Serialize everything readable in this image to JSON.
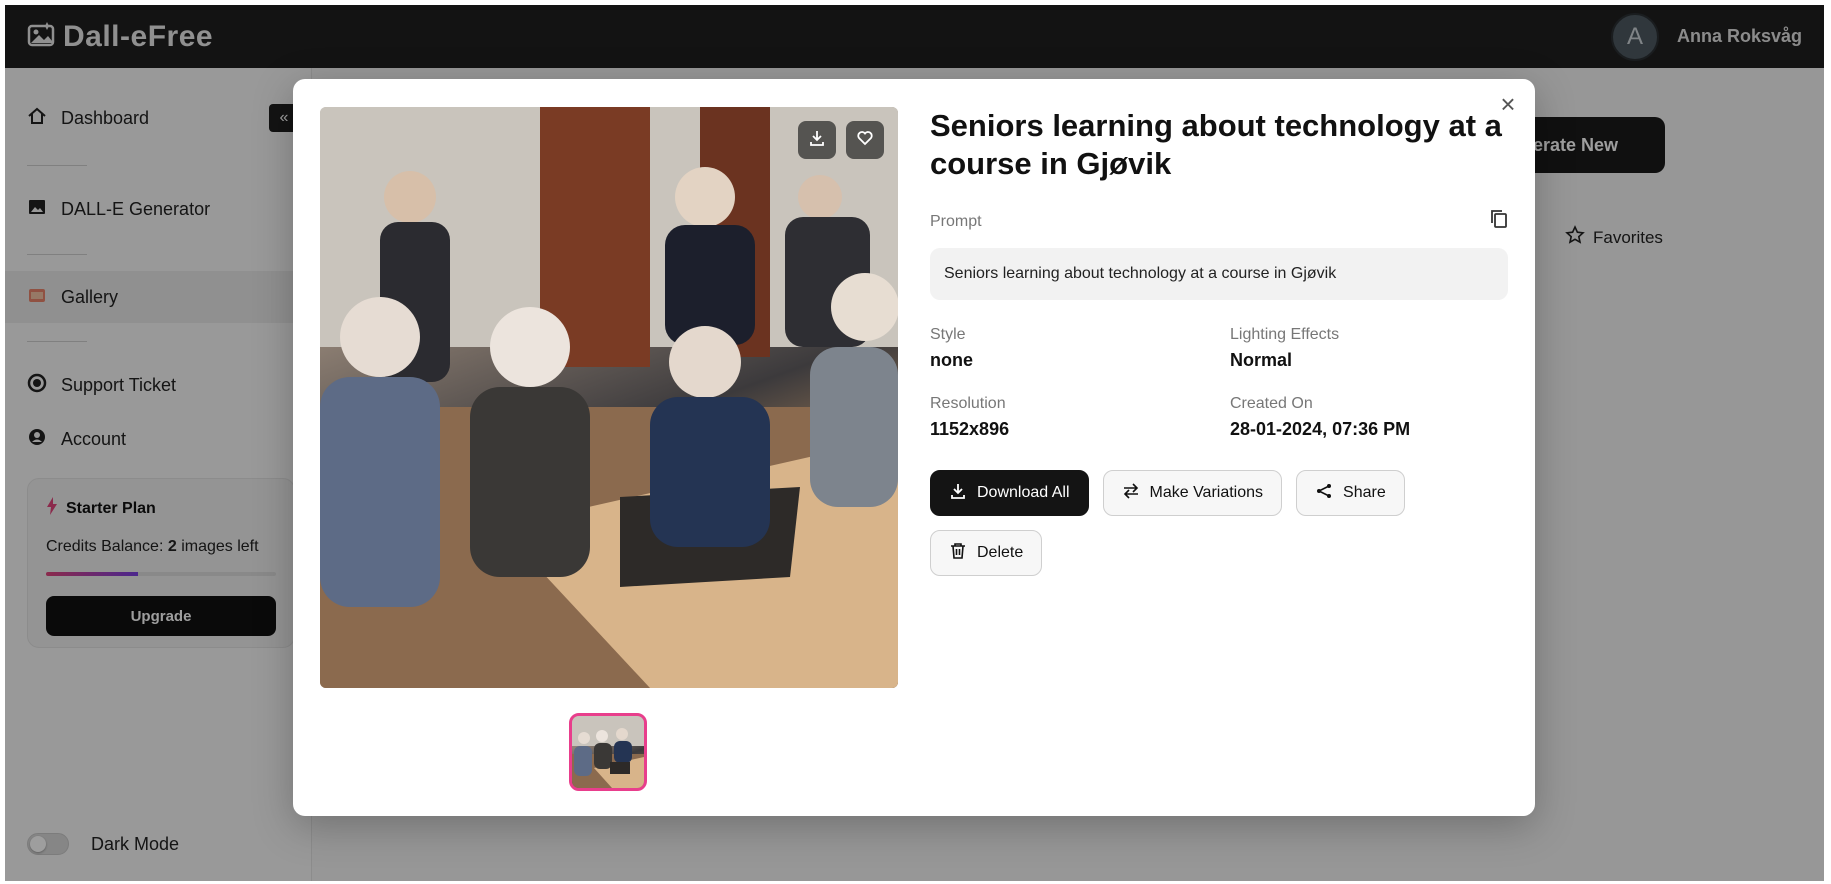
{
  "app": {
    "brand": "Dall-eFree",
    "user": {
      "initial": "A",
      "name": "Anna Roksvåg"
    }
  },
  "sidebar": {
    "items": [
      {
        "label": "Dashboard",
        "icon": "home-icon"
      },
      {
        "label": "DALL-E Generator",
        "icon": "image-icon"
      },
      {
        "label": "Gallery",
        "icon": "gallery-icon"
      },
      {
        "label": "Support Ticket",
        "icon": "headset-icon"
      },
      {
        "label": "Account",
        "icon": "user-circle-icon"
      }
    ],
    "plan": {
      "title": "Starter Plan",
      "credits_prefix": "Credits Balance: ",
      "credits_value": "2",
      "credits_suffix": " images left",
      "progress": 0.4,
      "upgrade_label": "Upgrade"
    },
    "dark_mode_label": "Dark Mode"
  },
  "background": {
    "generate_label": "enerate New",
    "favorites_label": "Favorites"
  },
  "modal": {
    "title": "Seniors learning about technology at a course in Gjøvik",
    "prompt_label": "Prompt",
    "prompt_text": "Seniors learning about technology at a course in Gjøvik",
    "style_label": "Style",
    "style_value": "none",
    "lighting_label": "Lighting Effects",
    "lighting_value": "Normal",
    "resolution_label": "Resolution",
    "resolution_value": "1152x896",
    "created_label": "Created On",
    "created_value": "28-01-2024, 07:36 PM",
    "actions": {
      "download_all": "Download All",
      "make_variations": "Make Variations",
      "share": "Share",
      "delete": "Delete"
    }
  },
  "colors": {
    "topbar": "#1f1f1f",
    "primary_button": "#141414",
    "thumb_border": "#e83e8c",
    "progress_start": "#e0457b",
    "progress_end": "#7b3fe4"
  }
}
